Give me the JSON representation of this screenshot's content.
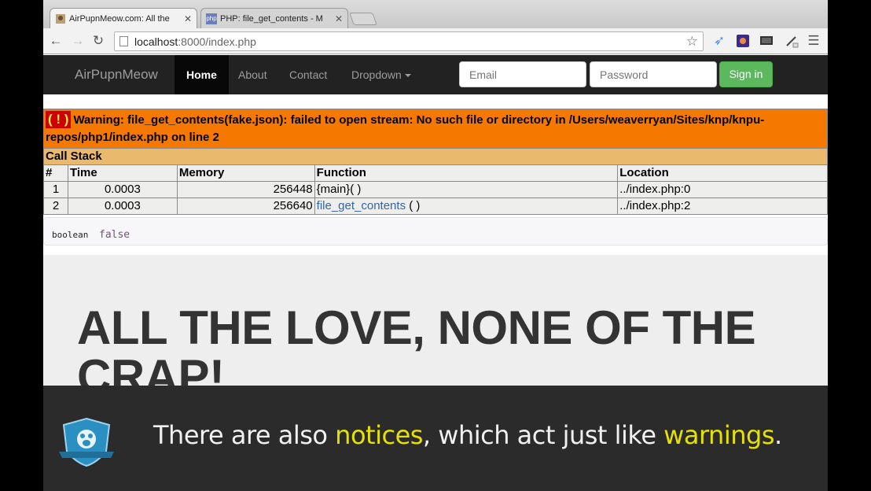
{
  "browser": {
    "tabs": [
      {
        "label": "AirPupnMeow.com: All the",
        "active": true
      },
      {
        "label": "PHP: file_get_contents - M",
        "active": false
      }
    ],
    "url_host": "localhost",
    "url_rest": ":8000/index.php"
  },
  "navbar": {
    "brand": "AirPupnMeow",
    "links": [
      "Home",
      "About",
      "Contact",
      "Dropdown"
    ],
    "email_placeholder": "Email",
    "password_placeholder": "Password",
    "signin_label": "Sign in"
  },
  "xdebug": {
    "badge": "( ! )",
    "warning": "Warning: file_get_contents(fake.json): failed to open stream: No such file or directory in /Users/weaverryan/Sites/knp/knpu-repos/php1/index.php on line 2",
    "callstack_label": "Call Stack",
    "headers": [
      "#",
      "Time",
      "Memory",
      "Function",
      "Location"
    ],
    "rows": [
      {
        "num": "1",
        "time": "0.0003",
        "memory": "256448",
        "function": "{main}( )",
        "location": "../index.php:0"
      },
      {
        "num": "2",
        "time": "0.0003",
        "memory": "256640",
        "function": "file_get_contents",
        "function_suffix": " ( )",
        "location": "../index.php:2"
      }
    ]
  },
  "dump": {
    "type": "boolean",
    "value": "false"
  },
  "hero": {
    "title": "ALL THE LOVE, NONE OF THE CRAP!"
  },
  "caption": {
    "part1": "There are also ",
    "highlight1": "notices",
    "part2": ", which act just like ",
    "highlight2": "warnings",
    "part3": "."
  },
  "colors": {
    "warning_bg": "#f57900",
    "callstack_bg": "#e9b96e",
    "caption_highlight": "#e5e100",
    "signin": "#5cb85c"
  }
}
